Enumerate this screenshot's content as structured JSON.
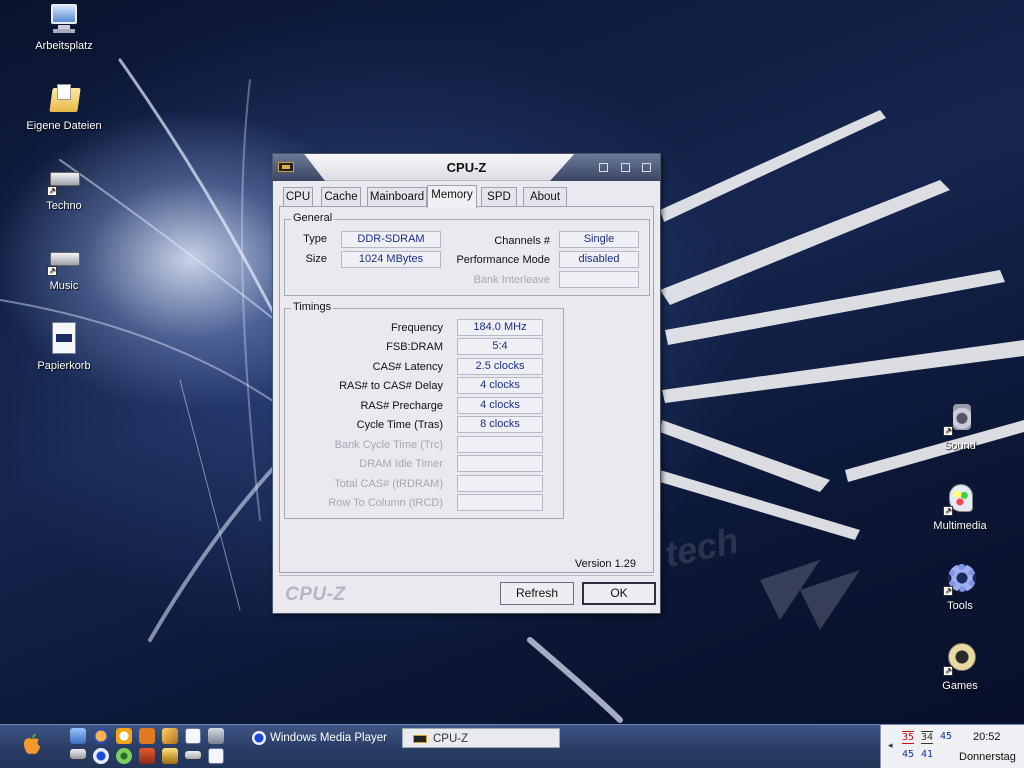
{
  "desktop": {
    "icons_left": [
      {
        "label": "Arbeitsplatz",
        "icon": "my-computer-icon"
      },
      {
        "label": "Eigene Dateien",
        "icon": "my-documents-icon"
      },
      {
        "label": "Techno",
        "icon": "drive-shortcut-icon"
      },
      {
        "label": "Music",
        "icon": "drive-shortcut-icon"
      },
      {
        "label": "Papierkorb",
        "icon": "recycle-bin-icon"
      }
    ],
    "icons_right": [
      {
        "label": "Sound",
        "icon": "speaker-icon"
      },
      {
        "label": "Multimedia",
        "icon": "multimedia-icon"
      },
      {
        "label": "Tools",
        "icon": "gear-icon"
      },
      {
        "label": "Games",
        "icon": "games-icon"
      }
    ]
  },
  "window": {
    "title": "CPU-Z",
    "tabs": [
      {
        "label": "CPU"
      },
      {
        "label": "Cache"
      },
      {
        "label": "Mainboard"
      },
      {
        "label": "Memory",
        "active": true
      },
      {
        "label": "SPD"
      },
      {
        "label": "About"
      }
    ],
    "general": {
      "legend": "General",
      "type_label": "Type",
      "type_value": "DDR-SDRAM",
      "size_label": "Size",
      "size_value": "1024 MBytes",
      "channels_label": "Channels #",
      "channels_value": "Single",
      "perf_mode_label": "Performance Mode",
      "perf_mode_value": "disabled",
      "bank_interleave_label": "Bank Interleave",
      "bank_interleave_value": ""
    },
    "timings": {
      "legend": "Timings",
      "rows": [
        {
          "label": "Frequency",
          "value": "184.0 MHz",
          "enabled": true
        },
        {
          "label": "FSB:DRAM",
          "value": "5:4",
          "enabled": true
        },
        {
          "label": "CAS# Latency",
          "value": "2.5 clocks",
          "enabled": true
        },
        {
          "label": "RAS# to CAS# Delay",
          "value": "4 clocks",
          "enabled": true
        },
        {
          "label": "RAS# Precharge",
          "value": "4 clocks",
          "enabled": true
        },
        {
          "label": "Cycle Time (Tras)",
          "value": "8 clocks",
          "enabled": true
        },
        {
          "label": "Bank Cycle Time (Trc)",
          "value": "",
          "enabled": false
        },
        {
          "label": "DRAM Idle Timer",
          "value": "",
          "enabled": false
        },
        {
          "label": "Total CAS# (tRDRAM)",
          "value": "",
          "enabled": false
        },
        {
          "label": "Row To Column (tRCD)",
          "value": "",
          "enabled": false
        }
      ]
    },
    "version": "Version 1.29",
    "brand": "CPU-Z",
    "refresh_label": "Refresh",
    "ok_label": "OK"
  },
  "taskbar": {
    "start_icon": "apple-icon",
    "tasks": [
      {
        "label": "Windows Media Player",
        "icon": "media-player-icon"
      },
      {
        "label": "CPU-Z",
        "icon": "cpu-chip-icon"
      }
    ],
    "tray": {
      "temps_top": [
        "35",
        "34",
        "45"
      ],
      "temps_bottom": [
        "45",
        "41"
      ],
      "time": "20:52",
      "day": "Donnerstag"
    }
  },
  "colors": {
    "value_text": "#1c2e8c",
    "taskbar": "#2a3e68",
    "temp_red": "#cc1111",
    "temp_blue": "#1133aa"
  }
}
